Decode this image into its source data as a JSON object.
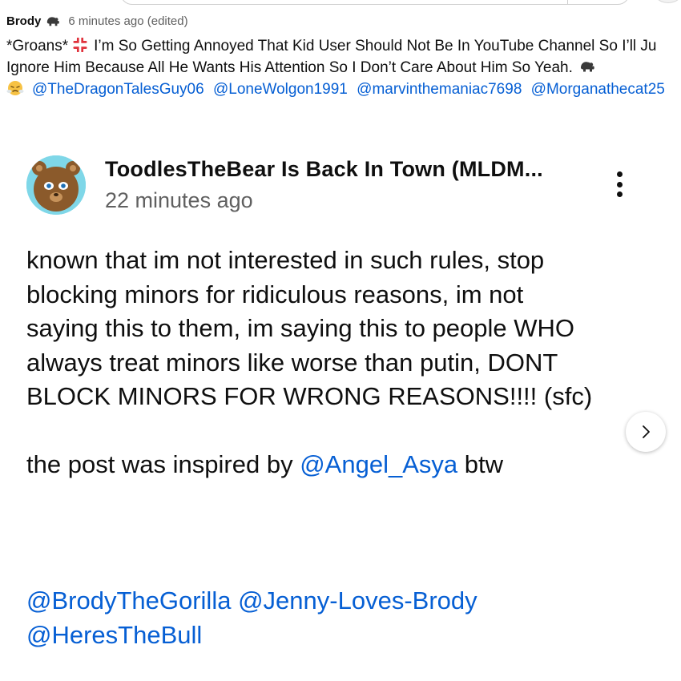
{
  "comment": {
    "author": "Brody",
    "timestamp": "6 minutes ago (edited)",
    "text_line1_a": "*Groans*",
    "text_line1_b": "I’m So Getting Annoyed That Kid User Should Not Be In YouTube Channel So I’ll Ju",
    "text_line2": "Ignore Him Because All He Wants His Attention So I Don’t Care About Him So Yeah.",
    "mentions": [
      "@TheDragonTalesGuy06",
      "@LoneWolgon1991",
      "@marvinthemaniac7698",
      "@Morganathecat25"
    ],
    "icons": [
      "gorilla-icon",
      "anger-symbol-icon",
      "gorilla-icon",
      "face-with-steam-icon"
    ]
  },
  "post": {
    "author": "ToodlesTheBear Is Back In Town (MLDM...",
    "timestamp": "22 minutes ago",
    "avatar_icon": "bear-avatar",
    "menu_icon": "more-vertical-icon",
    "body_lines": [
      "known that im not interested in such rules, stop",
      "blocking minors for ridiculous reasons, im not",
      "saying this to them, im saying this to people WHO",
      "always treat minors like worse than putin, DONT",
      "BLOCK MINORS FOR WRONG REASONS!!!! (sfc)"
    ],
    "inspired_prefix": "the post was inspired by",
    "inspired_mention": "@Angel_Asya",
    "inspired_suffix": "btw",
    "tag_mentions_line1": [
      "@BrodyTheGorilla",
      "@Jenny-Loves-Brody"
    ],
    "tag_mentions_line2": [
      "@HeresTheBull"
    ],
    "next_icon": "chevron-right-icon"
  },
  "colors": {
    "link": "#065fd4",
    "text": "#0f0f0f",
    "secondary_text": "#606060",
    "avatar_bg": "#7fd7e8"
  }
}
